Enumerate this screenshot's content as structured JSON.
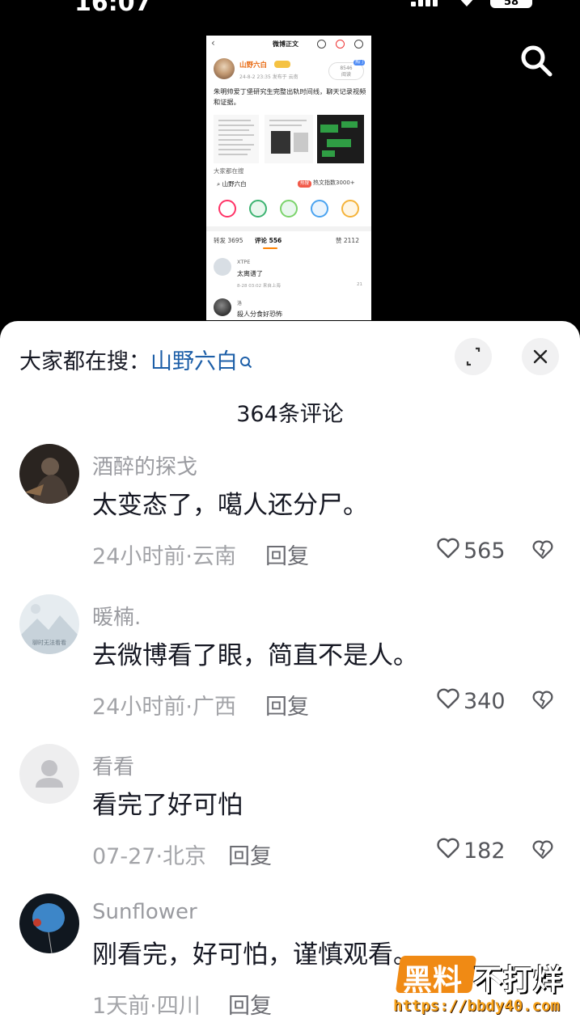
{
  "status_bar": {
    "time": "16:07",
    "battery": "58"
  },
  "video_preview": {
    "nav_title": "微博正文",
    "author_name": "山野六白",
    "post_time": "24-8-2 23:35 发布于 云南",
    "views_count": "8546",
    "views_label": "阅读",
    "views_tag": "热门",
    "post_text": "朱明帅爱丁堡研究生完整出轨时间线，聊天记录视频和证据。",
    "search_label": "大家都在搜",
    "search_keyword": "山野六白",
    "hot_badge": "热搜",
    "hot_text": "热文指数3000+",
    "stats": {
      "repost": "转发 3695",
      "comments": "评论 556",
      "likes": "赞 2112"
    },
    "comment1": {
      "name": "XTPE",
      "text": "太离谱了",
      "meta": "8-28 03:02  来自上海",
      "likes": "21"
    },
    "comment2": {
      "name": "洛",
      "text": "殺人分食好恐怖"
    }
  },
  "sheet": {
    "search_prefix": "大家都在搜：",
    "search_keyword": "山野六白",
    "comment_count": "364条评论",
    "reply_label": "回复",
    "comments": [
      {
        "name": "酒醉的探戈",
        "text": "太变态了，噶人还分尸。",
        "meta": "24小时前·云南",
        "likes": "565"
      },
      {
        "name": "暖楠.",
        "text": "去微博看了眼，简直不是人。",
        "meta": "24小时前·广西",
        "likes": "340",
        "avatar_caption": "聊时无法看看"
      },
      {
        "name": "看看",
        "text": "看完了好可怕",
        "meta": "07-27·北京",
        "likes": "182"
      },
      {
        "name": "Sunflower",
        "text": "刚看完，好可怕，谨慎观看。",
        "meta": "1天前·四川"
      }
    ]
  },
  "watermark": {
    "part1": "黑料",
    "part2": "不打烊",
    "url": "https://bbdy40.com"
  },
  "colors": {
    "keyword": "#1d5fa8",
    "accent": "#ff8200",
    "watermark": "#f08a14"
  }
}
